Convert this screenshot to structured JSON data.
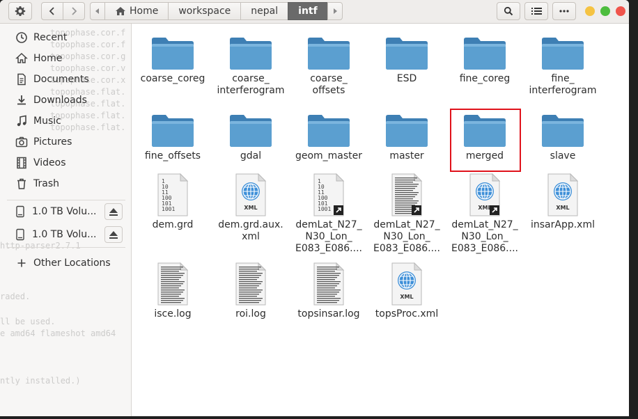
{
  "window": {
    "path": [
      {
        "label": "Home",
        "icon": "home-icon"
      },
      {
        "label": "workspace"
      },
      {
        "label": "nepal"
      },
      {
        "label": "intf",
        "active": true
      }
    ]
  },
  "terminal": {
    "lines": [
      "topophase.cor.f",
      "topophase.cor.f",
      "topophase.cor.g",
      "topophase.cor.v",
      "topophase.cor.x",
      "topophase.flat.",
      "topophase.flat.",
      "topophase.flat.",
      "topophase.flat.",
      "http-parser2.7.1",
      "raded.",
      "ll be used.",
      "e amd64 flameshot amd64",
      "ntly installed.)"
    ]
  },
  "sidebar": {
    "places": [
      {
        "label": "Recent",
        "icon": "clock-icon"
      },
      {
        "label": "Home",
        "icon": "home-icon"
      },
      {
        "label": "Documents",
        "icon": "document-icon"
      },
      {
        "label": "Downloads",
        "icon": "download-icon"
      },
      {
        "label": "Music",
        "icon": "music-icon"
      },
      {
        "label": "Pictures",
        "icon": "camera-icon"
      },
      {
        "label": "Videos",
        "icon": "film-icon"
      },
      {
        "label": "Trash",
        "icon": "trash-icon"
      }
    ],
    "volumes": [
      {
        "label": "1.0 TB Volu...",
        "icon": "drive-icon"
      },
      {
        "label": "1.0 TB Volu...",
        "icon": "drive-icon"
      }
    ],
    "other": {
      "label": "Other Locations",
      "icon": "plus-icon"
    }
  },
  "files": [
    {
      "name": [
        "coarse_coreg"
      ],
      "type": "folder"
    },
    {
      "name": [
        "coarse_",
        "interferogram"
      ],
      "type": "folder"
    },
    {
      "name": [
        "coarse_",
        "offsets"
      ],
      "type": "folder"
    },
    {
      "name": [
        "ESD"
      ],
      "type": "folder"
    },
    {
      "name": [
        "fine_coreg"
      ],
      "type": "folder"
    },
    {
      "name": [
        "fine_",
        "interferogram"
      ],
      "type": "folder"
    },
    {
      "name": [
        "fine_offsets"
      ],
      "type": "folder"
    },
    {
      "name": [
        "gdal"
      ],
      "type": "folder"
    },
    {
      "name": [
        "geom_master"
      ],
      "type": "folder"
    },
    {
      "name": [
        "master"
      ],
      "type": "folder"
    },
    {
      "name": [
        "merged"
      ],
      "type": "folder",
      "highlighted": true
    },
    {
      "name": [
        "slave"
      ],
      "type": "folder"
    },
    {
      "name": [
        "dem.grd"
      ],
      "type": "binary"
    },
    {
      "name": [
        "dem.grd.aux.",
        "xml"
      ],
      "type": "xml"
    },
    {
      "name": [
        "demLat_N27_",
        "N30_Lon_",
        "E083_E086...."
      ],
      "type": "binary-link"
    },
    {
      "name": [
        "demLat_N27_",
        "N30_Lon_",
        "E083_E086...."
      ],
      "type": "text-link"
    },
    {
      "name": [
        "demLat_N27_",
        "N30_Lon_",
        "E083_E086...."
      ],
      "type": "xml-link"
    },
    {
      "name": [
        "insarApp.xml"
      ],
      "type": "xml"
    },
    {
      "name": [
        "isce.log"
      ],
      "type": "text"
    },
    {
      "name": [
        "roi.log"
      ],
      "type": "text"
    },
    {
      "name": [
        "topsinsar.log"
      ],
      "type": "text"
    },
    {
      "name": [
        "topsProc.xml"
      ],
      "type": "xml"
    }
  ],
  "icon_labels": {
    "xml": "XML",
    "binary": [
      "1",
      "10",
      "11",
      "100",
      "101",
      "1001"
    ]
  },
  "colors": {
    "folder": "#5b9fd0",
    "highlight": "#e0121b",
    "active_crumb": "#6a6a6a"
  }
}
